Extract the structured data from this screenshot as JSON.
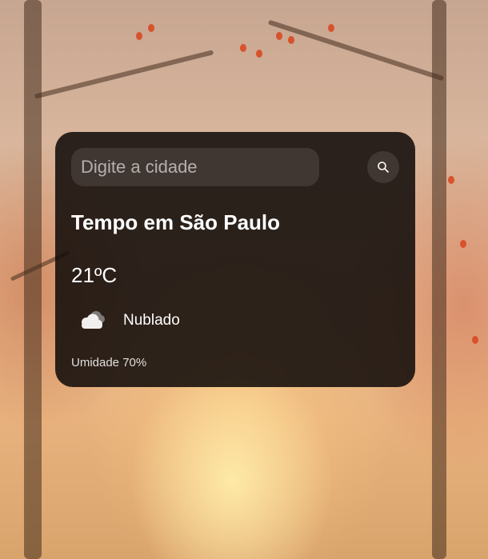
{
  "search": {
    "placeholder": "Digite a cidade",
    "value": ""
  },
  "weather": {
    "title": "Tempo em São Paulo",
    "temperature": "21ºC",
    "condition": "Nublado",
    "humidity": "Umidade 70%"
  },
  "icons": {
    "search_button": "search-icon",
    "condition": "cloud-icon"
  },
  "colors": {
    "card_background": "#120d0a",
    "text": "#ffffff",
    "leaf_accent": "#d8522c"
  }
}
